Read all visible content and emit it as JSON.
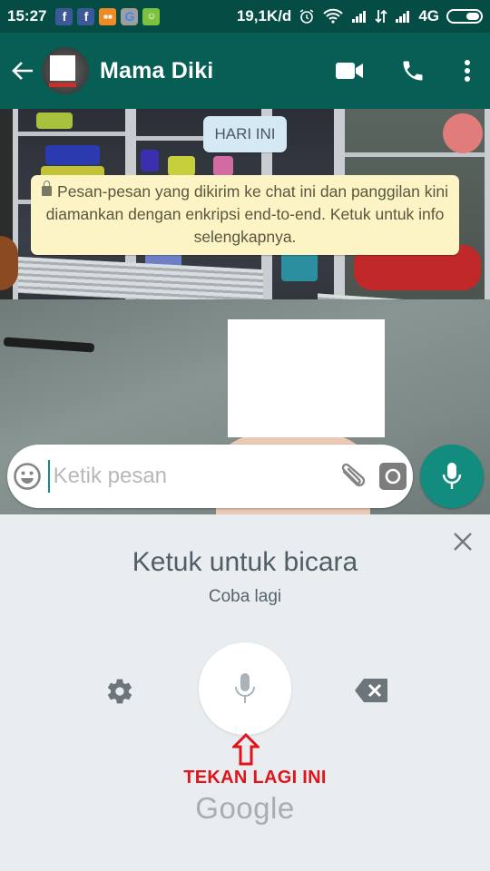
{
  "status_bar": {
    "time": "15:27",
    "notification_icons": [
      "facebook-icon",
      "facebook-icon",
      "chat-app-icon",
      "google-icon",
      "android-icon"
    ],
    "network_speed": "19,1K/d",
    "network_type": "4G",
    "right_icons": [
      "alarm-icon",
      "wifi-icon",
      "signal-icon",
      "data-arrows-icon",
      "signal-icon",
      "battery-icon"
    ]
  },
  "app_bar": {
    "back_icon": "arrow-left-icon",
    "contact_name": "Mama Diki",
    "actions": [
      "video-call-icon",
      "phone-icon",
      "more-vert-icon"
    ]
  },
  "chat": {
    "date_chip": "HARI INI",
    "system_message": "Pesan-pesan yang dikirim ke chat ini dan panggilan kini diamankan dengan enkripsi end-to-end. Ketuk untuk info selengkapnya.",
    "system_message_icon": "lock-icon"
  },
  "composer": {
    "placeholder": "Ketik pesan",
    "value": "",
    "emoji_icon": "emoji-icon",
    "attach_icon": "paperclip-icon",
    "camera_icon": "camera-icon",
    "send_icon": "mic-icon"
  },
  "voice_panel": {
    "title": "Ketuk untuk bicara",
    "subtitle": "Coba lagi",
    "annotation": "TEKAN LAGI INI",
    "brand": "Google",
    "icons": [
      "close-icon",
      "gear-icon",
      "mic-icon",
      "backspace-icon",
      "arrow-up-icon"
    ]
  },
  "colors": {
    "status_bar": "#054d44",
    "app_bar": "#075e54",
    "accent": "#128c7e",
    "system_message_bg": "#fcf4c4",
    "date_chip_bg": "#d5e9f4",
    "voice_panel_bg": "#e9edf0",
    "annotation": "#e0151b"
  }
}
